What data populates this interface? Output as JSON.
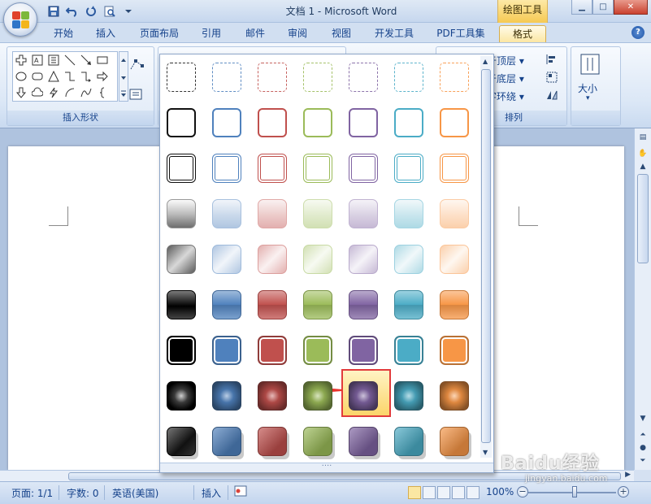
{
  "window": {
    "title": "文档 1 - Microsoft Word",
    "context_tab": "绘图工具",
    "controls": [
      "minimize",
      "maximize",
      "close"
    ]
  },
  "tabs": [
    {
      "label": "开始",
      "active": false
    },
    {
      "label": "插入",
      "active": false
    },
    {
      "label": "页面布局",
      "active": false
    },
    {
      "label": "引用",
      "active": false
    },
    {
      "label": "邮件",
      "active": false
    },
    {
      "label": "审阅",
      "active": false
    },
    {
      "label": "视图",
      "active": false
    },
    {
      "label": "开发工具",
      "active": false
    },
    {
      "label": "PDF工具集",
      "active": false
    },
    {
      "label": "格式",
      "active": true
    }
  ],
  "ribbon": {
    "insert_shapes_label": "插入形状",
    "arrange_label": "排列",
    "bring_to_front": "置于顶层",
    "send_to_back": "置于底层",
    "text_wrapping": "文字环绕",
    "size_label": "大小"
  },
  "gallery": {
    "columns": [
      "black",
      "blue",
      "red",
      "green",
      "purple",
      "aqua",
      "orange"
    ],
    "column_colors": [
      "#1a1a1a",
      "#4f81bd",
      "#c0504d",
      "#9bbb59",
      "#8064a2",
      "#4bacc6",
      "#f79646"
    ],
    "rows": [
      "dashed-outline",
      "outline",
      "double-outline",
      "light-gradient",
      "diagonal-gradient",
      "strong-gradient",
      "filled-border",
      "glow-star",
      "shadowed"
    ],
    "selected": {
      "row": 7,
      "column": 4
    }
  },
  "status": {
    "page": "页面: 1/1",
    "words": "字数: 0",
    "language": "英语(美国)",
    "mode": "插入",
    "zoom": "100%"
  },
  "watermark": {
    "main": "Baidu经验",
    "sub": "jingyan.baidu.com"
  }
}
